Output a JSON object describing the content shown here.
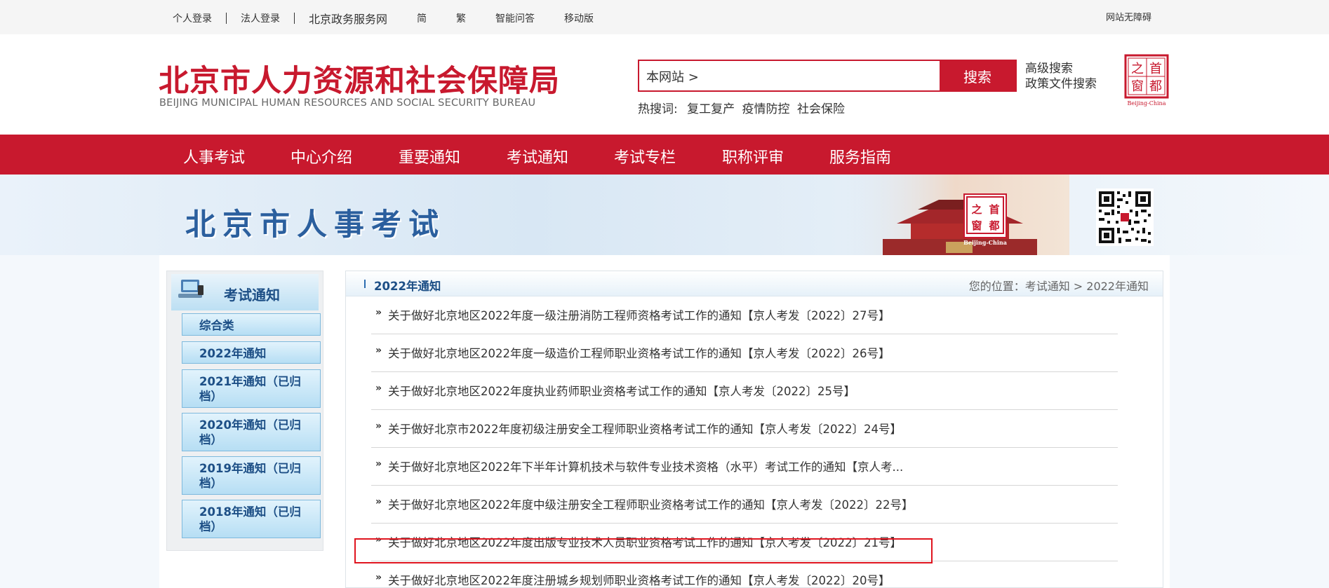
{
  "topbar": {
    "personal_login": "个人登录",
    "legal_login": "法人登录",
    "service_portal": "北京政务服务网",
    "simplified": "简",
    "traditional": "繁",
    "smart_qa": "智能问答",
    "mobile": "移动版",
    "accessible": "网站无障碍"
  },
  "header": {
    "logo_cn": "北京市人力资源和社会保障局",
    "logo_en": "BEIJING MUNICIPAL HUMAN RESOURCES AND SOCIAL SECURITY BUREAU",
    "search_value": "本网站 >",
    "search_button": "搜索",
    "advanced_search": "高级搜索",
    "policy_search": "政策文件搜索",
    "hot_label": "热搜词:",
    "hot_words": [
      "复工复产",
      "疫情防控",
      "社会保险"
    ],
    "seal_text": [
      "之",
      "首",
      "窗",
      "都"
    ],
    "seal_caption": "Beijing-China"
  },
  "nav": {
    "items": [
      "人事考试",
      "中心介绍",
      "重要通知",
      "考试通知",
      "考试专栏",
      "职称评审",
      "服务指南"
    ]
  },
  "banner": {
    "title": "北京市人事考试",
    "seal_text": [
      "之",
      "首",
      "窗",
      "都"
    ],
    "seal_caption": "Beijing-China"
  },
  "sidebar": {
    "title": "考试通知",
    "items": [
      "综合类",
      "2022年通知",
      "2021年通知（已归档）",
      "2020年通知（已归档）",
      "2019年通知（已归档）",
      "2018年通知（已归档）"
    ]
  },
  "content": {
    "title": "2022年通知",
    "breadcrumb": "您的位置：考试通知 > 2022年通知",
    "arrow": "»",
    "news": [
      "关于做好北京地区2022年度一级注册消防工程师资格考试工作的通知【京人考发〔2022〕27号】",
      "关于做好北京地区2022年度一级造价工程师职业资格考试工作的通知【京人考发〔2022〕26号】",
      "关于做好北京地区2022年度执业药师职业资格考试工作的通知【京人考发〔2022〕25号】",
      "关于做好北京市2022年度初级注册安全工程师职业资格考试工作的通知【京人考发〔2022〕24号】",
      "关于做好北京地区2022年下半年计算机技术与软件专业技术资格（水平）考试工作的通知【京人考...",
      "关于做好北京地区2022年度中级注册安全工程师职业资格考试工作的通知【京人考发〔2022〕22号】",
      "关于做好北京地区2022年度出版专业技术人员职业资格考试工作的通知【京人考发〔2022〕21号】",
      "关于做好北京地区2022年度注册城乡规划师职业资格考试工作的通知【京人考发〔2022〕20号】"
    ]
  },
  "colors": {
    "brand_red": "#c8192e",
    "sidebar_blue": "#1d4f86",
    "highlight_red": "#e0151f"
  }
}
